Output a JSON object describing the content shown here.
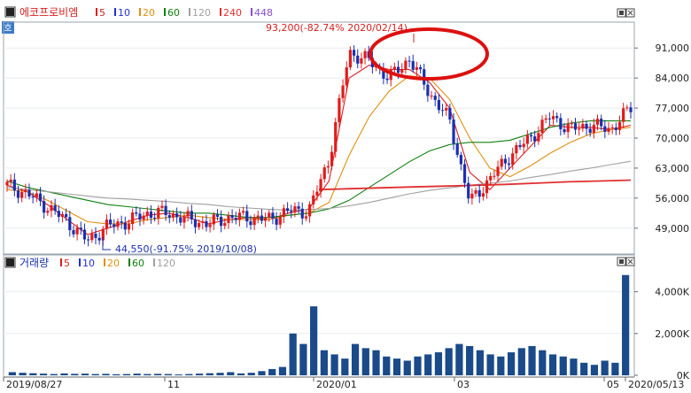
{
  "price_panel": {
    "stock_name": "에코프로비엠",
    "mode_badge": "호",
    "ma_legend": [
      {
        "label": "5",
        "color": "#d62020"
      },
      {
        "label": "10",
        "color": "#2030d0"
      },
      {
        "label": "20",
        "color": "#e09010"
      },
      {
        "label": "60",
        "color": "#108010"
      },
      {
        "label": "120",
        "color": "#a0a0a0"
      },
      {
        "label": "240",
        "color": "#e03030"
      },
      {
        "label": "448",
        "color": "#8a50d0"
      }
    ],
    "high_annotation": "93,200(-82.74% 2020/02/14)",
    "low_annotation": "44,550(-91.75% 2019/10/08)",
    "y_ticks": [
      "91,000",
      "84,000",
      "77,000",
      "70,000",
      "63,000",
      "56,000",
      "49,000"
    ]
  },
  "volume_panel": {
    "title": "거래량",
    "ma_legend": [
      {
        "label": "5",
        "color": "#d62020"
      },
      {
        "label": "10",
        "color": "#2030d0"
      },
      {
        "label": "20",
        "color": "#e09010"
      },
      {
        "label": "60",
        "color": "#108010"
      },
      {
        "label": "120",
        "color": "#a0a0a0"
      }
    ],
    "y_ticks": [
      "4,000K",
      "2,000K",
      "0K"
    ]
  },
  "x_axis": {
    "labels": [
      "2019/08/27",
      "11",
      "2020/01",
      "03",
      "05",
      "2020/05/13"
    ]
  },
  "colors": {
    "up": "#e21b1b",
    "down": "#1a2fb0",
    "volume_bar": "#1a4a8a",
    "annotation": "#d62020"
  },
  "chart_data": [
    {
      "type": "candlestick",
      "title": "에코프로비엠",
      "x_range": [
        "2019/08/27",
        "2020/05/13"
      ],
      "ylim": [
        44000,
        96000
      ],
      "series": [
        {
          "name": "close",
          "values": [
            59000,
            57000,
            54000,
            50500,
            46000,
            49500,
            50500,
            52500,
            52500,
            51000,
            50000,
            51500,
            51500,
            51000,
            53000,
            53000,
            65000,
            90000,
            88000,
            84000,
            88500,
            80500,
            74000,
            55000,
            60500,
            66000,
            70000,
            75000,
            72000,
            73000,
            72000,
            77000
          ]
        },
        {
          "name": "5",
          "values": [
            59000,
            57500,
            54500,
            51000,
            47500,
            49000,
            50500,
            52000,
            52500,
            51500,
            50000,
            51000,
            51500,
            51000,
            52500,
            53500,
            60000,
            84000,
            87000,
            86000,
            86000,
            83000,
            77000,
            62000,
            58000,
            63000,
            68000,
            73000,
            72500,
            72500,
            72000,
            73000
          ]
        },
        {
          "name": "20",
          "values": [
            58000,
            57500,
            55500,
            53000,
            50500,
            50000,
            50000,
            51000,
            51500,
            52000,
            51500,
            51000,
            51000,
            51000,
            52000,
            52500,
            55000,
            66000,
            75000,
            81000,
            84500,
            84000,
            79000,
            70000,
            63000,
            61000,
            63500,
            66500,
            69000,
            71000,
            72000,
            72500
          ]
        },
        {
          "name": "60",
          "values": [
            60000,
            58500,
            57500,
            56500,
            55500,
            54500,
            54000,
            53500,
            53000,
            52500,
            52500,
            52000,
            51500,
            51500,
            52000,
            52500,
            53500,
            55500,
            58500,
            61500,
            64500,
            67000,
            68500,
            69000,
            69000,
            69500,
            71000,
            72500,
            73500,
            74000,
            74000,
            74000
          ]
        },
        {
          "name": "120",
          "values": [
            58500,
            58000,
            57500,
            57000,
            56500,
            56000,
            55800,
            55500,
            55200,
            54800,
            54500,
            54000,
            53700,
            53400,
            53200,
            53300,
            53600,
            54200,
            55000,
            56000,
            57000,
            57800,
            58400,
            59000,
            59500,
            60000,
            60800,
            61500,
            62300,
            63000,
            63800,
            64600
          ]
        },
        {
          "name": "240",
          "values": [
            58000,
            58200,
            58400,
            58600,
            58800,
            59000,
            59200,
            59500,
            59800,
            60000,
            60200
          ]
        }
      ],
      "annotations": [
        {
          "label": "93,200(-82.74% 2020/02/14)",
          "x": "2020/02/14",
          "y": 93200
        },
        {
          "label": "44,550(-91.75% 2019/10/08)",
          "x": "2019/10/08",
          "y": 44550
        }
      ]
    },
    {
      "type": "bar",
      "title": "거래량",
      "unit": "K",
      "ylim": [
        0,
        5000
      ],
      "values": [
        150,
        120,
        100,
        80,
        60,
        90,
        70,
        80,
        60,
        70,
        50,
        60,
        80,
        60,
        70,
        60,
        40,
        60,
        80,
        100,
        120,
        150,
        90,
        120,
        200,
        300,
        400,
        2000,
        1500,
        3300,
        1200,
        1000,
        800,
        1500,
        1300,
        1200,
        900,
        800,
        700,
        900,
        1000,
        1100,
        1300,
        1500,
        1400,
        1200,
        1000,
        900,
        1100,
        1300,
        1400,
        1200,
        1000,
        900,
        800,
        600,
        500,
        700,
        600,
        4800
      ]
    }
  ]
}
